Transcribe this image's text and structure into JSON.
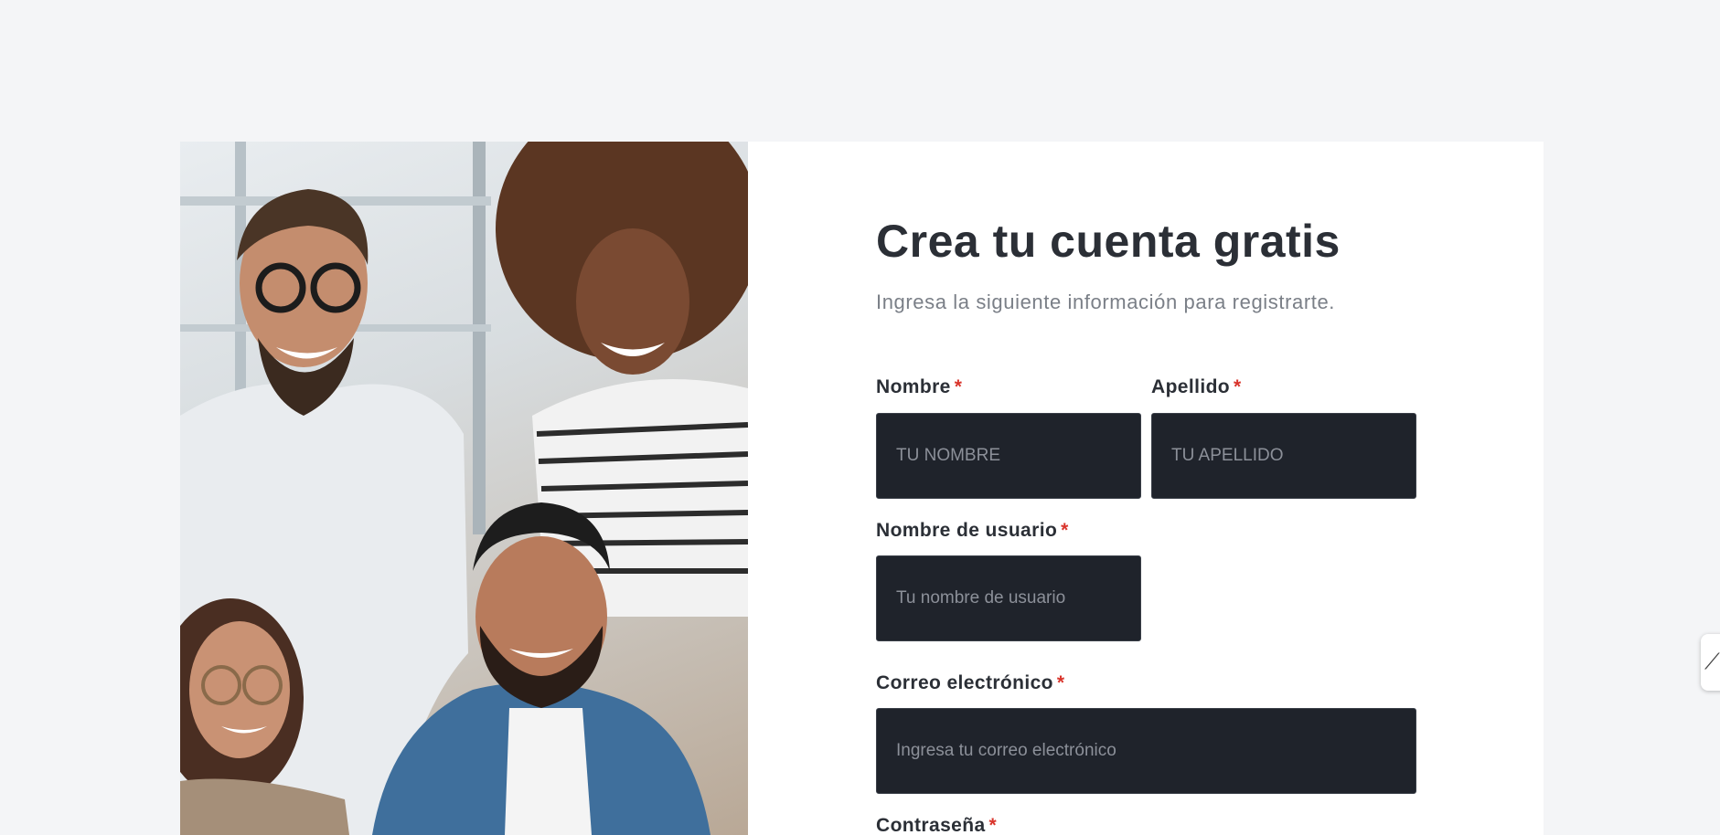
{
  "form": {
    "title": "Crea tu cuenta gratis",
    "subtitle": "Ingresa la siguiente información para registrarte.",
    "required_marker": "*",
    "fields": {
      "first_name": {
        "label": "Nombre",
        "placeholder": "TU NOMBRE"
      },
      "last_name": {
        "label": "Apellido",
        "placeholder": "TU APELLIDO"
      },
      "username": {
        "label": "Nombre de usuario",
        "placeholder": "Tu nombre de usuario"
      },
      "email": {
        "label": "Correo electrónico",
        "placeholder": "Ingresa tu correo electrónico"
      },
      "password": {
        "label": "Contraseña"
      }
    }
  },
  "side_tab": {
    "icon": "chart-trend-icon"
  },
  "colors": {
    "page_bg": "#f4f5f7",
    "field_bg": "#1f232b",
    "required": "#d9342b",
    "heading": "#2b2f36"
  }
}
